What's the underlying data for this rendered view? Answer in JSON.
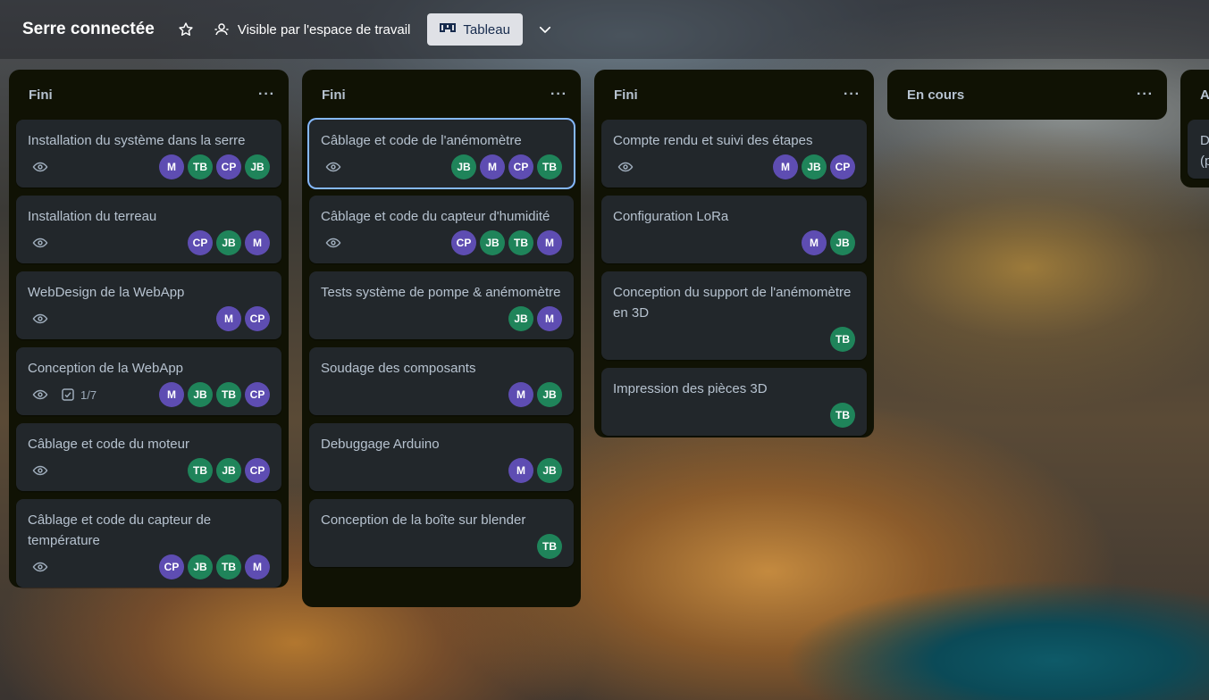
{
  "header": {
    "board_title": "Serre connectée",
    "visibility_label": "Visible par l'espace de travail",
    "view_label": "Tableau"
  },
  "colors": {
    "M": "#5e4db2",
    "JB": "#1f845a",
    "TB": "#1f845a",
    "CP": "#5e4db2"
  },
  "lists": [
    {
      "title": "Fini",
      "menu": "···",
      "cards": [
        {
          "title": "Installation du système dans la serre",
          "eye": true,
          "members": [
            "M",
            "TB",
            "CP",
            "JB"
          ]
        },
        {
          "title": "Installation du terreau",
          "eye": true,
          "members": [
            "CP",
            "JB",
            "M"
          ]
        },
        {
          "title": "WebDesign de la WebApp",
          "eye": true,
          "members": [
            "M",
            "CP"
          ]
        },
        {
          "title": "Conception de la WebApp",
          "eye": true,
          "checklist": "1/7",
          "members": [
            "M",
            "JB",
            "TB",
            "CP"
          ]
        },
        {
          "title": "Câblage et code du moteur",
          "eye": true,
          "members": [
            "TB",
            "JB",
            "CP"
          ]
        },
        {
          "title": "Câblage et code du capteur de température",
          "eye": true,
          "members": [
            "CP",
            "JB",
            "TB",
            "M"
          ]
        }
      ]
    },
    {
      "title": "Fini",
      "menu": "···",
      "cards": [
        {
          "title": "Câblage et code de l'anémomètre",
          "eye": true,
          "selected": true,
          "members": [
            "JB",
            "M",
            "CP",
            "TB"
          ]
        },
        {
          "title": "Câblage et code du capteur d'humidité",
          "eye": true,
          "members": [
            "CP",
            "JB",
            "TB",
            "M"
          ]
        },
        {
          "title": "Tests système de pompe & anémomètre",
          "members": [
            "JB",
            "M"
          ]
        },
        {
          "title": "Soudage des composants",
          "members": [
            "M",
            "JB"
          ]
        },
        {
          "title": "Debuggage Arduino",
          "members": [
            "M",
            "JB"
          ]
        },
        {
          "title": "Conception de la boîte sur blender",
          "members": [
            "TB"
          ]
        }
      ]
    },
    {
      "title": "Fini",
      "menu": "···",
      "cards": [
        {
          "title": "Compte rendu et suivi des étapes",
          "eye": true,
          "members": [
            "M",
            "JB",
            "CP"
          ]
        },
        {
          "title": "Configuration LoRa",
          "members": [
            "M",
            "JB"
          ]
        },
        {
          "title": "Conception du support de l'anémomètre en 3D",
          "members": [
            "TB"
          ]
        },
        {
          "title": "Impression des pièces 3D",
          "members": [
            "TB"
          ]
        }
      ]
    },
    {
      "title": "En cours",
      "menu": "···",
      "cards": []
    },
    {
      "title": "A",
      "menu": "",
      "cards": [
        {
          "title": "D (p",
          "members": []
        }
      ]
    }
  ]
}
